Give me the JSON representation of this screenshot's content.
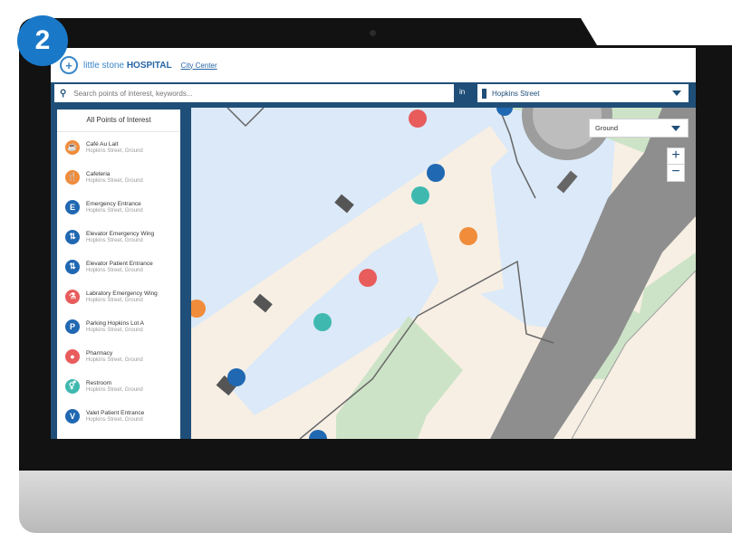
{
  "step_badge": "2",
  "header": {
    "logo_prefix": "little stone ",
    "logo_bold": "HOSPITAL",
    "city_link": "City Center"
  },
  "search": {
    "placeholder": "Search points of interest, keywords...",
    "in_label": "in",
    "building": "Hopkins Street"
  },
  "sidebar": {
    "title": "All Points of Interest",
    "items": [
      {
        "name": "Café Au Lait",
        "sub": "Hopkins Street, Ground",
        "icon": "coffee-icon",
        "glyph": "☕",
        "color": "#f08c3a"
      },
      {
        "name": "Cafeteria",
        "sub": "Hopkins Street, Ground",
        "icon": "utensils-icon",
        "glyph": "🍴",
        "color": "#f08c3a"
      },
      {
        "name": "Emergency Entrance",
        "sub": "Hopkins Street, Ground",
        "icon": "emergency-entrance-icon",
        "glyph": "E",
        "color": "#2068b2"
      },
      {
        "name": "Elevator Emergency Wing",
        "sub": "Hopkins Street, Ground",
        "icon": "elevator-icon",
        "glyph": "⇅",
        "color": "#2068b2"
      },
      {
        "name": "Elevator Patient Entrance",
        "sub": "Hopkins Street, Ground",
        "icon": "elevator-icon",
        "glyph": "⇅",
        "color": "#2068b2"
      },
      {
        "name": "Labratory Emergency Wing",
        "sub": "Hopkins Street, Ground",
        "icon": "microscope-icon",
        "glyph": "⚗",
        "color": "#e85c5c"
      },
      {
        "name": "Parking Hopkins Lot A",
        "sub": "Hopkins Street, Ground",
        "icon": "parking-icon",
        "glyph": "P",
        "color": "#2068b2"
      },
      {
        "name": "Pharmacy",
        "sub": "Hopkins Street, Ground",
        "icon": "pill-icon",
        "glyph": "●",
        "color": "#e85c5c"
      },
      {
        "name": "Restroom",
        "sub": "Hopkins Street, Ground",
        "icon": "restroom-icon",
        "glyph": "⚥",
        "color": "#3fb9b0"
      },
      {
        "name": "Valet Patient Entrance",
        "sub": "Hopkins Street, Ground",
        "icon": "valet-icon",
        "glyph": "V",
        "color": "#2068b2"
      }
    ]
  },
  "map": {
    "floor": "Ground",
    "zoom_in": "+",
    "zoom_out": "−"
  },
  "colors": {
    "brand_blue": "#1f4f78",
    "accent_blue": "#3a86c8",
    "orange": "#f08c3a",
    "red": "#e85c5c",
    "teal": "#3fb9b0",
    "poi_blue": "#2068b2"
  }
}
